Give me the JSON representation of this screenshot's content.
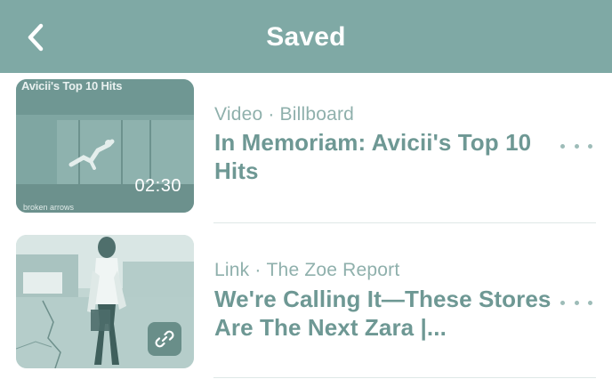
{
  "header": {
    "title": "Saved",
    "back_icon": "chevron-left-icon"
  },
  "colors": {
    "header_bg": "#7fa9a5",
    "title_text": "#6e9894",
    "meta_text": "#8fb0ac",
    "divider": "#dfe8e7"
  },
  "items": [
    {
      "type": "Video",
      "source": "Billboard",
      "separator": "·",
      "title": "In Memoriam: Avicii's Top 10 Hits",
      "thumbnail_text": "Avicii's Top 10 Hits",
      "thumbnail_footer": "broken arrows",
      "duration": "02:30",
      "more_icon": "more-horizontal-icon"
    },
    {
      "type": "Link",
      "source": "The Zoe Report",
      "separator": "·",
      "title": "We're Calling It—These Stores Are The Next Zara |...",
      "badge_icon": "link-icon",
      "more_icon": "more-horizontal-icon"
    }
  ]
}
